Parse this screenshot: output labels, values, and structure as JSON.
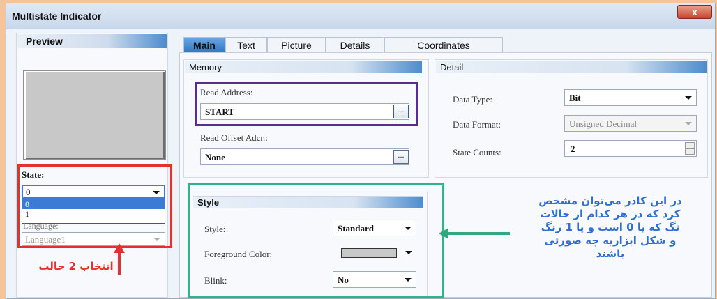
{
  "window": {
    "title": "Multistate Indicator",
    "close_label": "x"
  },
  "preview": {
    "title": "Preview"
  },
  "state": {
    "label": "State:",
    "selected": "0",
    "options": [
      "0",
      "1"
    ]
  },
  "language": {
    "label": "Language:",
    "value": "Language1"
  },
  "tabs": [
    "Main",
    "Text",
    "Picture",
    "Details",
    "Coordinates"
  ],
  "memory": {
    "title": "Memory",
    "read_address_label": "Read Address:",
    "read_address_value": "START",
    "read_offset_label": "Read Offset Adcr.:",
    "read_offset_value": "None",
    "browse_label": "..."
  },
  "detail": {
    "title": "Detail",
    "data_type_label": "Data Type:",
    "data_type_value": "Bit",
    "data_format_label": "Data Format:",
    "data_format_value": "Unsigned Decimal",
    "state_counts_label": "State Counts:",
    "state_counts_value": "2"
  },
  "style": {
    "title": "Style",
    "style_label": "Style:",
    "style_value": "Standard",
    "fg_label": "Foreground Color:",
    "fg_color": "#c8c8c8",
    "blink_label": "Blink:",
    "blink_value": "No"
  },
  "annotations": {
    "left_note": "انتخاب 2 حالت",
    "right_note_lines": [
      "در این کادر می‌توان مشخص",
      "کرد که در هر کدام از حالات",
      "تگ که یا 0 است  و یا 1 رنگ",
      "و شکل ابزاریه چه صورتی",
      "باشند"
    ]
  },
  "colors": {
    "background": "#f4c49a",
    "red_box": "#e53030",
    "purple_box": "#5a2d8c",
    "green_box": "#2fb38a",
    "annotation_blue": "#2f6fd0"
  }
}
